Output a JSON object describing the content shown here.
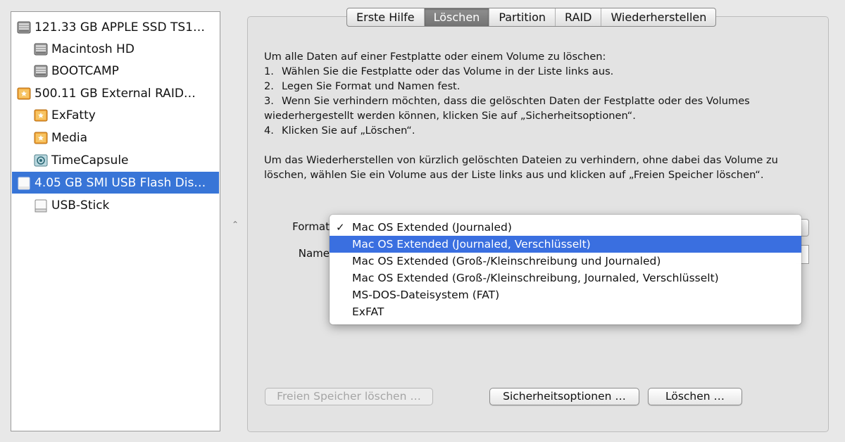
{
  "sidebar": {
    "items": [
      {
        "label": "121.33 GB APPLE SSD TS1…",
        "icon": "internal-disk-icon"
      },
      {
        "label": "Macintosh HD",
        "icon": "internal-volume-icon"
      },
      {
        "label": "BOOTCAMP",
        "icon": "internal-volume-icon"
      },
      {
        "label": "500.11 GB External RAID…",
        "icon": "external-disk-icon"
      },
      {
        "label": "ExFatty",
        "icon": "external-volume-icon"
      },
      {
        "label": "Media",
        "icon": "external-volume-icon"
      },
      {
        "label": "TimeCapsule",
        "icon": "network-volume-icon"
      },
      {
        "label": "4.05 GB SMI USB Flash Dis…",
        "icon": "usb-disk-icon",
        "selected": true
      },
      {
        "label": "USB-Stick",
        "icon": "usb-volume-icon"
      }
    ]
  },
  "tabs": [
    {
      "label": "Erste Hilfe"
    },
    {
      "label": "Löschen",
      "active": true
    },
    {
      "label": "Partition"
    },
    {
      "label": "RAID"
    },
    {
      "label": "Wiederherstellen"
    }
  ],
  "instructions": {
    "intro": "Um alle Daten auf einer Festplatte oder einem Volume zu löschen:",
    "steps": [
      {
        "num": "1.",
        "text": "Wählen Sie die Festplatte oder das Volume in der Liste links aus."
      },
      {
        "num": "2.",
        "text": "Legen Sie Format und Namen fest."
      },
      {
        "num": "3.",
        "text": "Wenn Sie verhindern möchten, dass die gelöschten Daten der Festplatte oder des Volumes wiederhergestellt werden können, klicken Sie auf „Sicherheitsoptionen“."
      },
      {
        "num": "4.",
        "text": "Klicken Sie auf „Löschen“."
      }
    ],
    "paragraph2": "Um das Wiederherstellen von kürzlich gelöschten Dateien zu verhindern, ohne dabei das Volume zu löschen, wählen Sie ein Volume aus der Liste links aus und klicken auf „Freien Speicher löschen“."
  },
  "form": {
    "format_label": "Format",
    "name_label": "Name"
  },
  "format_menu": {
    "checkmark": "✓",
    "options": [
      {
        "label": "Mac OS Extended (Journaled)",
        "checked": true
      },
      {
        "label": "Mac OS Extended (Journaled, Verschlüsselt)",
        "highlighted": true
      },
      {
        "label": "Mac OS Extended (Groß-/Kleinschreibung und Journaled)"
      },
      {
        "label": "Mac OS Extended (Groß-/Kleinschreibung, Journaled, Verschlüsselt)"
      },
      {
        "label": "MS-DOS-Dateisystem (FAT)"
      },
      {
        "label": "ExFAT"
      }
    ]
  },
  "buttons": {
    "erase_free_space": "Freien Speicher löschen …",
    "security_options": "Sicherheitsoptionen …",
    "erase": "Löschen …"
  },
  "colors": {
    "selection": "#3875d7",
    "menu_highlight": "#3a6fe0"
  }
}
